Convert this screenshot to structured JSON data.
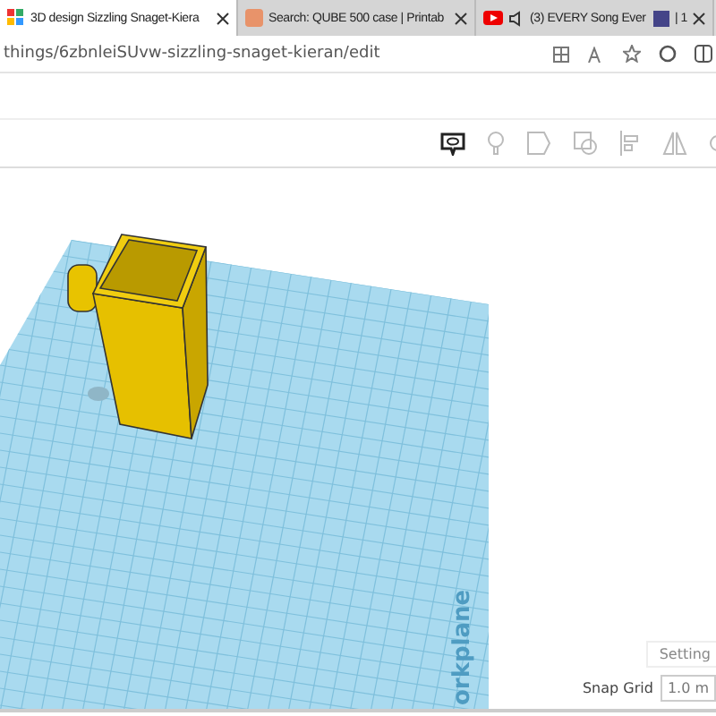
{
  "tabs": [
    {
      "title": "3D design Sizzling Snaget-Kiera",
      "kind": "grid",
      "selected": true
    },
    {
      "title": "Search: QUBE 500 case | Printab",
      "kind": "orange",
      "selected": false
    },
    {
      "title": "(3) EVERY Song Ever",
      "kind": "video",
      "suffix": "| 1",
      "selected": false
    }
  ],
  "address_bar": {
    "url": "things/6zbnleiSUvw-sizzling-snaget-kieran/edit"
  },
  "workplane": {
    "label": "orkplane"
  },
  "settings_button": "Setting",
  "snap_grid": {
    "label": "Snap Grid",
    "value": "1.0 m"
  }
}
